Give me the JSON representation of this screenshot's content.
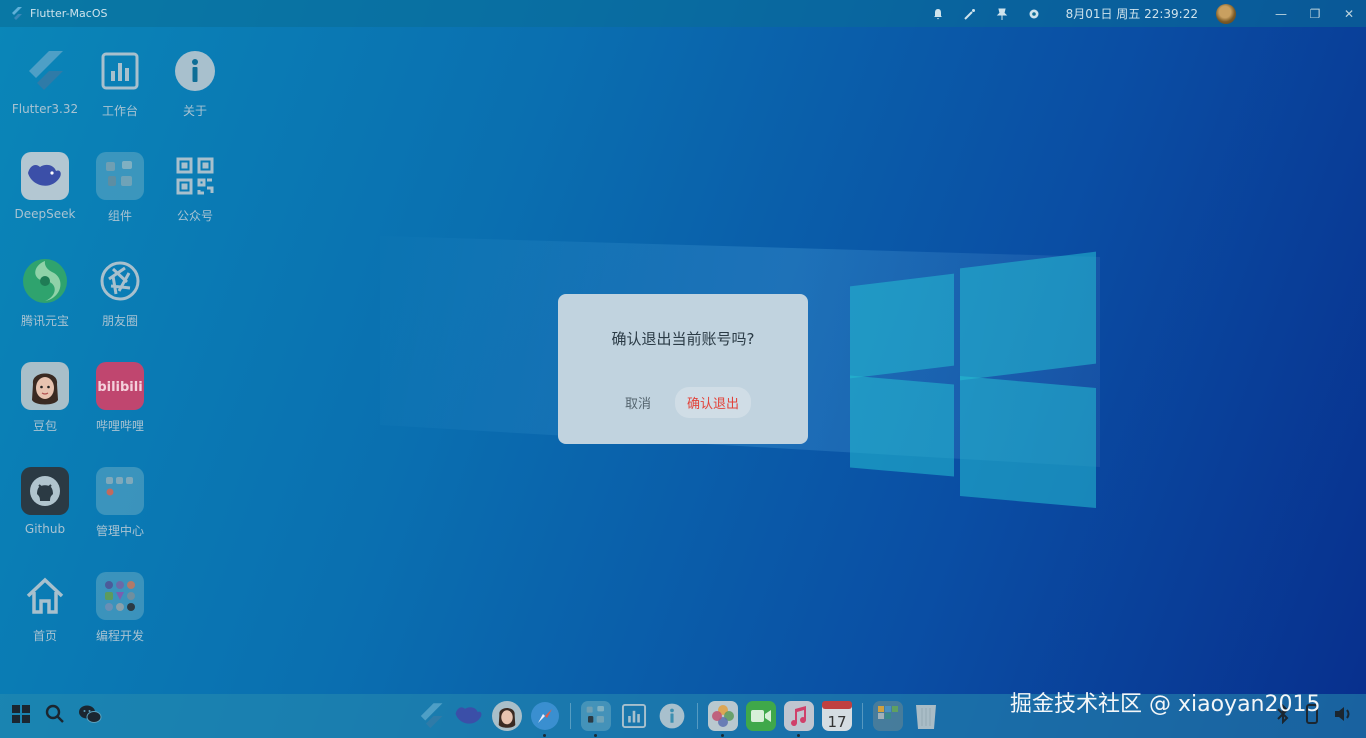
{
  "window": {
    "title": "Flutter-MacOS"
  },
  "topbar": {
    "datetime": "8月01日 周五 22:39:22",
    "icons": [
      "bell-icon",
      "magic-wand-icon",
      "pin-icon",
      "gear-icon",
      "avatar",
      "minimize-icon",
      "restore-icon",
      "close-icon"
    ],
    "minimize_glyph": "—",
    "restore_glyph": "❐",
    "close_glyph": "✕"
  },
  "desktop": {
    "icons": [
      {
        "label": "Flutter3.32",
        "icon": "flutter-icon"
      },
      {
        "label": "工作台",
        "icon": "dashboard-icon"
      },
      {
        "label": "关于",
        "icon": "info-icon"
      },
      {
        "label": "DeepSeek",
        "icon": "deepseek-icon"
      },
      {
        "label": "组件",
        "icon": "widgets-folder-icon"
      },
      {
        "label": "公众号",
        "icon": "qrcode-icon"
      },
      {
        "label": "腾讯元宝",
        "icon": "yuanbao-icon"
      },
      {
        "label": "朋友圈",
        "icon": "moments-icon"
      },
      {
        "label": "豆包",
        "icon": "doubao-icon"
      },
      {
        "label": "哔哩哔哩",
        "icon": "bilibili-icon"
      },
      {
        "label": "Github",
        "icon": "github-icon"
      },
      {
        "label": "管理中心",
        "icon": "admin-folder-icon"
      },
      {
        "label": "首页",
        "icon": "home-icon"
      },
      {
        "label": "编程开发",
        "icon": "dev-folder-icon"
      }
    ]
  },
  "dialog": {
    "message": "确认退出当前账号吗?",
    "cancel_label": "取消",
    "confirm_label": "确认退出"
  },
  "taskbar": {
    "left_icons": [
      "windows-start-icon",
      "search-icon",
      "wechat-icon"
    ],
    "dock": [
      "flutter-icon",
      "deepseek-icon",
      "doubao-icon",
      "safari-icon",
      "widgets-folder-icon",
      "dashboard-icon",
      "info-icon",
      "photos-icon",
      "facetime-icon",
      "music-icon",
      "calendar-icon",
      "apps-folder-icon",
      "trash-icon"
    ],
    "calendar_day": "17",
    "right_icons": [
      "bluetooth-icon",
      "phone-icon",
      "volume-icon"
    ]
  },
  "watermark": "掘金技术社区 @ xiaoyan2015",
  "colors": {
    "confirm": "#e2433a",
    "dialog_bg": "#c1d3df"
  }
}
